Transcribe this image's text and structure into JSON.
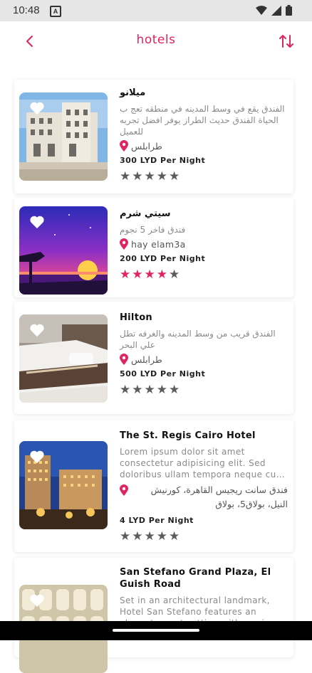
{
  "status": {
    "time": "10:48",
    "notif": "A"
  },
  "appbar": {
    "title": "hotels"
  },
  "colors": {
    "accent": "#e0245e"
  },
  "hotels": [
    {
      "name": "ميلانو",
      "desc": "الفندق يقع في وسط المدينه في منطقه تعج ب الحياة الفندق حديث الطراز يوفر افضل تجربه للعميل",
      "location": "طرابلس",
      "price": "300 LYD Per Night",
      "rating": 0
    },
    {
      "name": "سيتي شرم",
      "desc": "فندق فاخر 5 نجوم",
      "location": "hay elam3a",
      "price": "200 LYD Per Night",
      "rating": 4
    },
    {
      "name": "Hilton",
      "desc": "الفندق قريب من وسط المدينه والغرفه تطل علي البحر",
      "location": "طرابلس",
      "price": "500 LYD Per Night",
      "rating": 0
    },
    {
      "name": "The St. Regis Cairo Hotel",
      "desc": "Lorem ipsum dolor sit amet consectetur adipisicing elit. Sed doloribus ullam tempora neque cu…",
      "location": "فندق سانت ريجيس القاهرة، كورنيش النيل، بولاق5، بولاق",
      "price": "4 LYD Per Night",
      "rating": 0
    },
    {
      "name": "San Stefano Grand Plaza, El Guish Road",
      "desc": "Set in an architectural landmark, Hotel San Stefano features an elegant resort setting with a pri",
      "location": "",
      "price": "",
      "rating": 0
    }
  ]
}
